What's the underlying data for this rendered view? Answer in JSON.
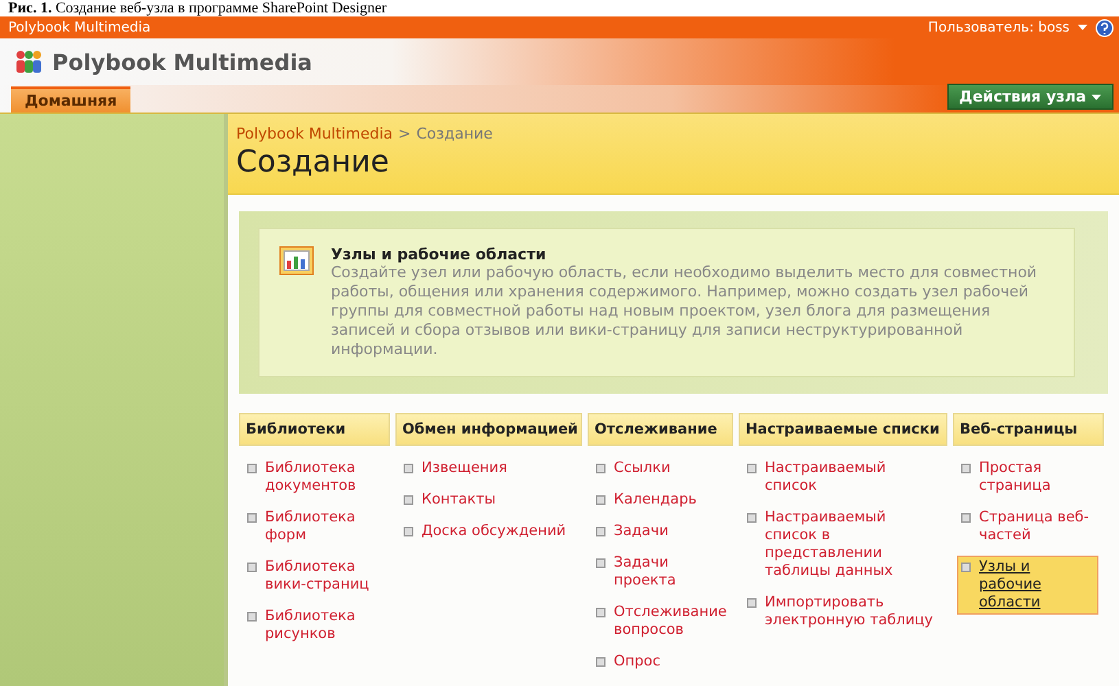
{
  "caption": {
    "label": "Рис. 1.",
    "text": "Создание веб-узла в программе SharePoint Designer"
  },
  "top_bar": {
    "site": "Polybook Multimedia",
    "user": "Пользователь: boss"
  },
  "header": {
    "title": "Polybook Multimedia"
  },
  "tabs": [
    {
      "label": "Домашняя",
      "selected": true
    }
  ],
  "site_actions": {
    "label": "Действия узла"
  },
  "breadcrumb": {
    "items": [
      "Polybook Multimedia",
      "Создание"
    ],
    "separator": ">"
  },
  "page_title": "Создание",
  "description": {
    "title": "Узлы и рабочие области",
    "text": "Создайте узел или рабочую область, если необходимо выделить место для совместной работы, общения или хранения содержимого. Например, можно создать узел рабочей группы для совместной работы над новым проектом, узел блога для размещения записей и сбора отзывов или вики-страницу для записи неструктурированной информации."
  },
  "categories": [
    {
      "title": "Библиотеки",
      "items": [
        {
          "label": "Библиотека документов",
          "selected": false
        },
        {
          "label": "Библиотека форм",
          "selected": false
        },
        {
          "label": "Библиотека вики-страниц",
          "selected": false
        },
        {
          "label": "Библиотека рисунков",
          "selected": false
        }
      ]
    },
    {
      "title": "Обмен информацией",
      "items": [
        {
          "label": "Извещения",
          "selected": false
        },
        {
          "label": "Контакты",
          "selected": false
        },
        {
          "label": "Доска обсуждений",
          "selected": false
        }
      ]
    },
    {
      "title": "Отслеживание",
      "items": [
        {
          "label": "Ссылки",
          "selected": false
        },
        {
          "label": "Календарь",
          "selected": false
        },
        {
          "label": "Задачи",
          "selected": false
        },
        {
          "label": "Задачи проекта",
          "selected": false
        },
        {
          "label": "Отслеживание вопросов",
          "selected": false
        },
        {
          "label": "Опрос",
          "selected": false
        }
      ]
    },
    {
      "title": "Настраиваемые списки",
      "items": [
        {
          "label": "Настраиваемый список",
          "selected": false
        },
        {
          "label": "Настраиваемый список в представлении таблицы данных",
          "selected": false
        },
        {
          "label": "Импортировать электронную таблицу",
          "selected": false
        }
      ]
    },
    {
      "title": "Веб-страницы",
      "items": [
        {
          "label": "Простая страница",
          "selected": false
        },
        {
          "label": "Страница веб-частей",
          "selected": false
        },
        {
          "label": "Узлы и рабочие области",
          "selected": true
        }
      ]
    }
  ]
}
